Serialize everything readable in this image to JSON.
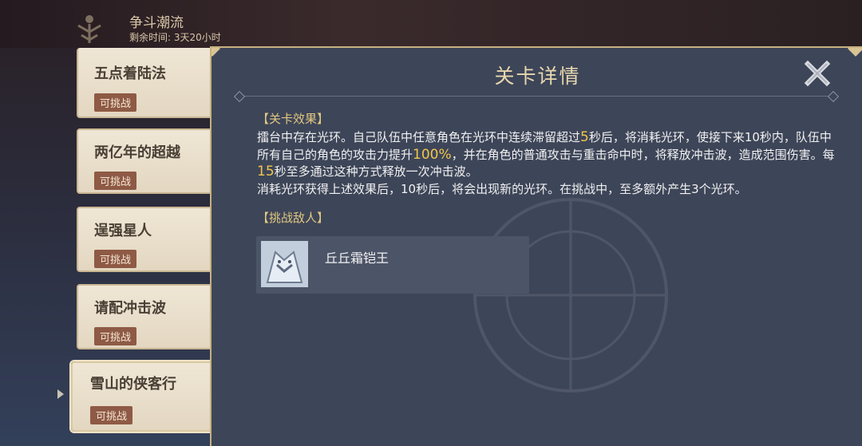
{
  "event": {
    "title": "争斗潮流",
    "remaining_label": "剩余时间:",
    "remaining_value": "3天20小时"
  },
  "stages": [
    {
      "name": "五点着陆法",
      "status": "可挑战"
    },
    {
      "name": "两亿年的超越",
      "status": "可挑战"
    },
    {
      "name": "逞强星人",
      "status": "可挑战"
    },
    {
      "name": "请配冲击波",
      "status": "可挑战"
    },
    {
      "name": "雪山的侠客行",
      "status": "可挑战",
      "selected": true
    }
  ],
  "dialog": {
    "title": "关卡详情",
    "effect_header": "【关卡效果】",
    "effect_parts": [
      "擂台中存在光环。自己队伍中任意角色在光环中连续滞留超过",
      "5",
      "秒后，将消耗光环，使接下来10秒内，队伍中所有自己的角色的攻击力提升",
      "100%",
      "，并在角色的普通攻击与重击命中时，将释放冲击波，造成范围伤害。每",
      "15",
      "秒至多通过这种方式释放一次冲击波。",
      "消耗光环获得上述效果后，10秒后，将会出现新的光环。在挑战中，至多额外产生3个光环。"
    ],
    "enemy_header": "【挑战敌人】",
    "enemy": {
      "name": "丘丘霜铠王",
      "icon": "frost-armor-lawachurl-portrait"
    }
  },
  "colors": {
    "accent_gold": "#e1c780",
    "highlight": "#f0c64b",
    "badge": "#8e5a45",
    "panel": "#3d4558"
  }
}
